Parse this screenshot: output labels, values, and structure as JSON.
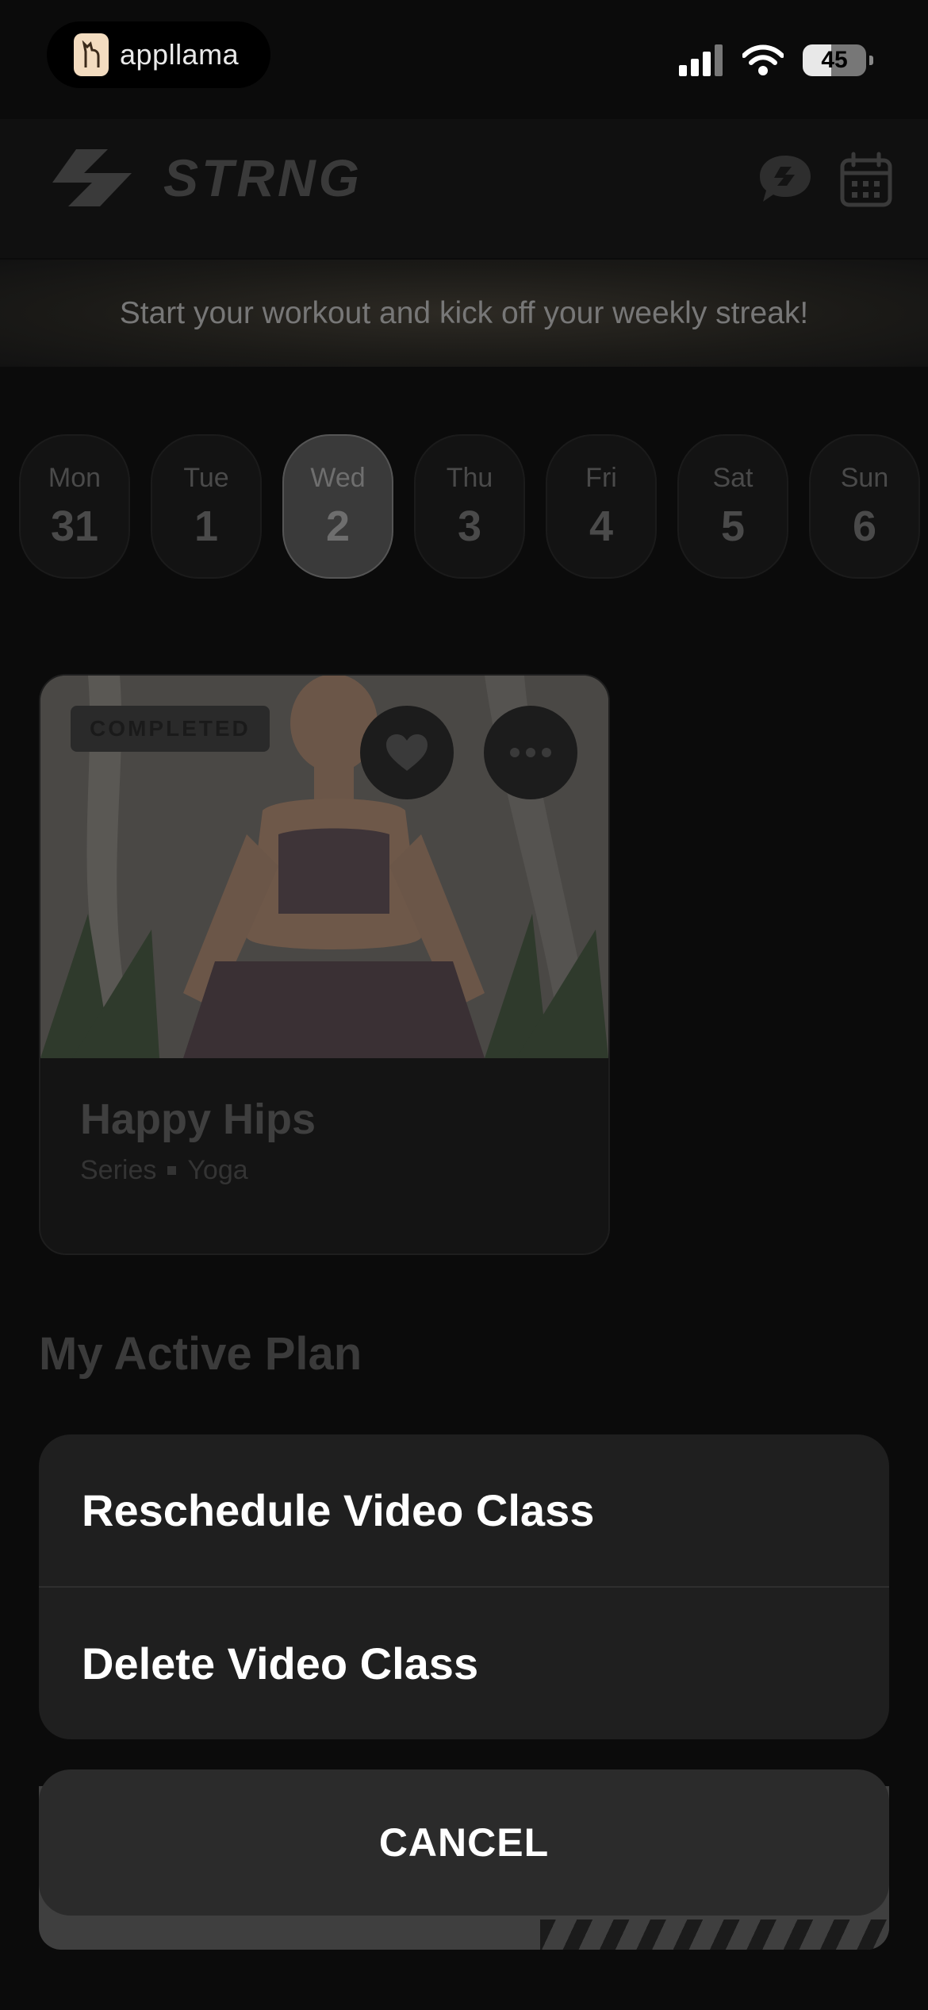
{
  "status_bar": {
    "app_badge": "appllama",
    "battery": "45"
  },
  "header": {
    "brand": "STRNG"
  },
  "banner": {
    "text": "Start your workout and kick off your weekly streak!"
  },
  "week": {
    "days": [
      {
        "name": "Mon",
        "date": "31"
      },
      {
        "name": "Tue",
        "date": "1"
      },
      {
        "name": "Wed",
        "date": "2",
        "selected": true
      },
      {
        "name": "Thu",
        "date": "3"
      },
      {
        "name": "Fri",
        "date": "4"
      },
      {
        "name": "Sat",
        "date": "5"
      },
      {
        "name": "Sun",
        "date": "6"
      }
    ]
  },
  "workout_card": {
    "badge": "COMPLETED",
    "title": "Happy Hips",
    "type": "Series",
    "category": "Yoga"
  },
  "section": {
    "title": "My Active Plan"
  },
  "action_sheet": {
    "reschedule": "Reschedule Video Class",
    "delete": "Delete Video Class",
    "cancel": "CANCEL"
  }
}
